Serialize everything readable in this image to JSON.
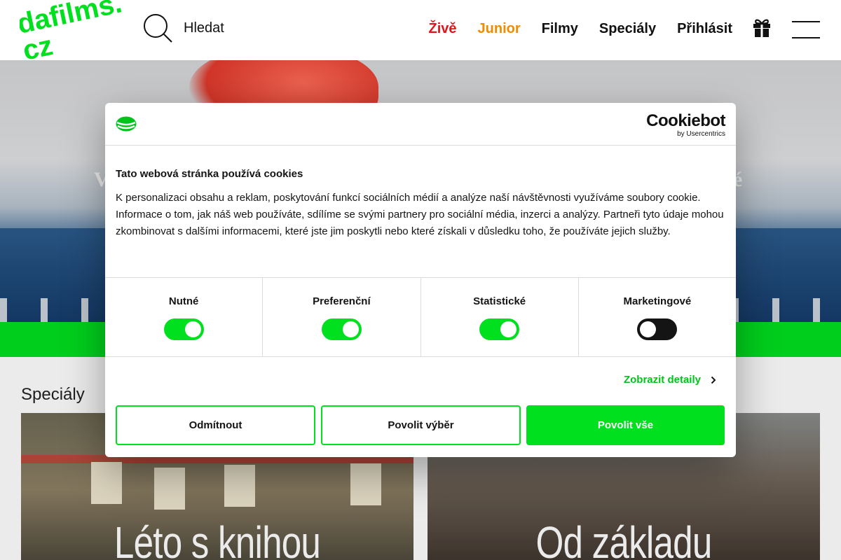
{
  "header": {
    "logo_text_line1": "dafilms.",
    "logo_text_line2": "cz",
    "search_label": "Hledat",
    "nav": {
      "live": "Živě",
      "junior": "Junior",
      "films": "Filmy",
      "specials": "Speciály",
      "login": "Přihlásit"
    },
    "gift_icon": "gift-icon",
    "menu_icon": "hamburger-menu-icon"
  },
  "hero": {
    "text_left": "V",
    "text_right": "é"
  },
  "section": {
    "title": "Speciály"
  },
  "cards": [
    {
      "title": "Léto s knihou"
    },
    {
      "title": "Od základu"
    }
  ],
  "cookie_dialog": {
    "brand_name": "Cookiebot",
    "brand_sub": "by Usercentrics",
    "title": "Tato webová stránka používá cookies",
    "text": "K personalizaci obsahu a reklam, poskytování funkcí sociálních médií a analýze naší návštěvnosti využíváme soubory cookie. Informace o tom, jak náš web používáte, sdílíme se svými partnery pro sociální média, inzerci a analýzy. Partneři tyto údaje mohou zkombinovat s dalšími informacemi, které jste jim poskytli nebo které získali v důsledku toho, že používáte jejich služby.",
    "categories": [
      {
        "label": "Nutné",
        "enabled": true
      },
      {
        "label": "Preferenční",
        "enabled": true
      },
      {
        "label": "Statistické",
        "enabled": true
      },
      {
        "label": "Marketingové",
        "enabled": false
      }
    ],
    "details_link": "Zobrazit detaily",
    "buttons": {
      "decline": "Odmítnout",
      "allow_selection": "Povolit výběr",
      "allow_all": "Povolit vše"
    }
  },
  "colors": {
    "accent_green": "#00e01f",
    "live_red": "#e0141b",
    "junior_orange": "#f08c00"
  }
}
